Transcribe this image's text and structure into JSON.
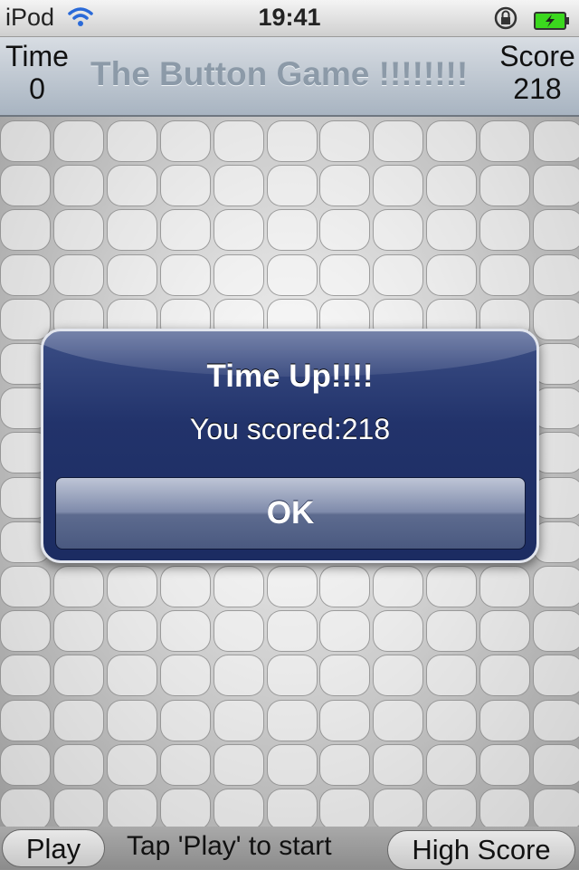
{
  "status_bar": {
    "carrier": "iPod",
    "time": "19:41"
  },
  "header": {
    "time_label": "Time",
    "time_value": "0",
    "title": "The Button Game !!!!!!!!",
    "score_label": "Score",
    "score_value": "218"
  },
  "board": {
    "rows": 16,
    "cols": 11
  },
  "alert": {
    "title": "Time Up!!!!",
    "message": "You scored:218",
    "ok_label": "OK"
  },
  "bottom": {
    "play_label": "Play",
    "hint": "Tap 'Play' to start",
    "high_score_label": "High Score"
  },
  "colors": {
    "alert_blue": "#22336b",
    "battery_green": "#3bd81e"
  },
  "icons": [
    "wifi-icon",
    "rotation-lock-icon",
    "battery-icon"
  ]
}
